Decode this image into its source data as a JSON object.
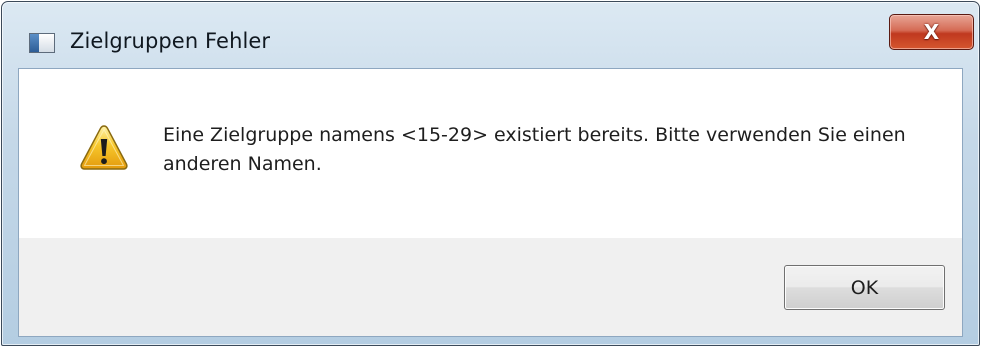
{
  "window": {
    "title": "Zielgruppen Fehler",
    "close_label": "X"
  },
  "dialog": {
    "icon": "warning-icon",
    "message": "Eine Zielgruppe namens <15-29> existiert bereits. Bitte verwenden Sie einen anderen Namen.",
    "ok_label": "OK"
  },
  "colors": {
    "title_bar": "#c5d8e8",
    "close_button": "#c0391f",
    "warning_fill": "#f7c72c",
    "button_strip": "#f0f0f0"
  }
}
